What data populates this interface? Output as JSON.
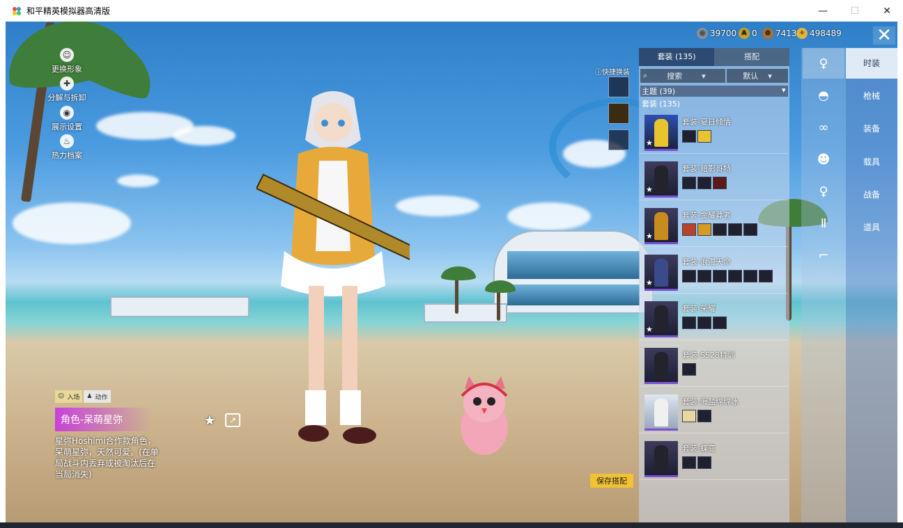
{
  "window": {
    "title": "和平精英模拟器高清版",
    "minimize": "—",
    "maximize": "☐",
    "close": "✕"
  },
  "left_menu": [
    {
      "label": "更换形象",
      "icon": "person-icon"
    },
    {
      "label": "分解与拆卸",
      "icon": "puzzle-icon"
    },
    {
      "label": "展示设置",
      "icon": "eye-icon"
    },
    {
      "label": "热力档案",
      "icon": "fire-icon"
    }
  ],
  "currency": [
    {
      "value": "39700",
      "icon": "gray-coin-icon",
      "color": "#8a8f99"
    },
    {
      "value": "0",
      "icon": "gold-a-coin-icon",
      "color": "#c9a227"
    },
    {
      "value": "7413",
      "icon": "bronze-coin-icon",
      "color": "#b0702e"
    },
    {
      "value": "498489",
      "icon": "gold-coin-icon",
      "color": "#e3b53a"
    }
  ],
  "panel": {
    "tabs": [
      {
        "label": "套装 (135)",
        "active": true
      },
      {
        "label": "搭配",
        "active": false
      }
    ],
    "search_label": "搜索",
    "sort_label": "默认",
    "theme_label": "主题 (39)",
    "suit_count": "套装 (135)",
    "items": [
      {
        "name": "套装-夏日倾情",
        "chips": 2
      },
      {
        "name": "套装-暗影哥特",
        "chips": 3
      },
      {
        "name": "套装-金耀莽者",
        "chips": 5
      },
      {
        "name": "套装-浪漫天命",
        "chips": 6
      },
      {
        "name": "套装-荣耀",
        "chips": 3
      },
      {
        "name": "套装-SS28特训",
        "chips": 1
      },
      {
        "name": "套装-海盐绵绵冰",
        "chips": 2
      },
      {
        "name": "套装-蝶变",
        "chips": 2
      }
    ]
  },
  "quick_swap": {
    "label": "快捷换装"
  },
  "categories": [
    {
      "label": "时装",
      "icon": "character-icon",
      "active": true
    },
    {
      "label": "枪械",
      "icon": "cap-icon",
      "active": false
    },
    {
      "label": "装备",
      "icon": "goggles-icon",
      "active": false
    },
    {
      "label": "载具",
      "icon": "face-icon",
      "active": false
    },
    {
      "label": "战备",
      "icon": "outfit-icon",
      "active": false
    },
    {
      "label": "道具",
      "icon": "pants-icon",
      "active": false
    },
    {
      "label": "",
      "icon": "shoes-icon",
      "active": false
    }
  ],
  "animation_tabs": [
    {
      "label": "入场",
      "active": true
    },
    {
      "label": "动作",
      "active": false
    }
  ],
  "character": {
    "title": "角色-呆萌星弥",
    "description": "星弥Hoshimi合作款角色，呆萌星弥，天然可爱。(在单局战斗内丢弃或被淘汰后在当局消失)"
  },
  "save_button": "保存搭配"
}
